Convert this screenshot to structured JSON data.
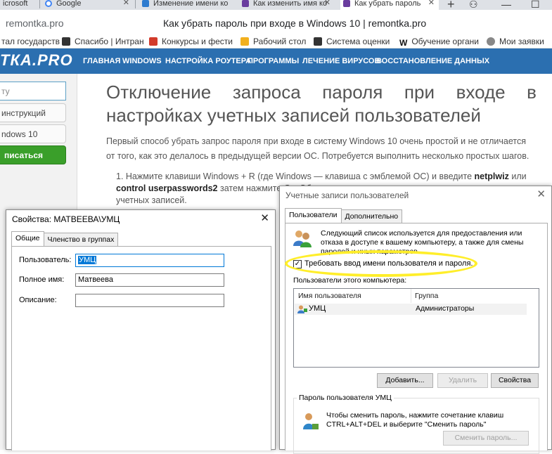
{
  "browser": {
    "tabs": [
      {
        "label": "icrosoft",
        "icon_color": "#2e7bcf"
      },
      {
        "label": "Google",
        "icon_color": "#4285f4"
      },
      {
        "label": "Изменение имени ко",
        "icon_color": "#2e7bcf"
      },
      {
        "label": "Как изменить имя ко",
        "icon_color": "#6a3c9e"
      },
      {
        "label": "Как убрать пароль",
        "icon_color": "#6a3c9e"
      }
    ],
    "url_host": "remontka.pro",
    "page_title": "Как убрать пароль при входе в Windows 10 | remontka.pro",
    "bookmarks": [
      {
        "label": "тал государств",
        "icon_color": "#c0392b"
      },
      {
        "label": "Спасибо | Интран",
        "icon_color": "#333333"
      },
      {
        "label": "Конкурсы и фести",
        "icon_color": "#d23b2b"
      },
      {
        "label": "Рабочий стол",
        "icon_color": "#f2b01e"
      },
      {
        "label": "Система оценки",
        "icon_color": "#333333"
      },
      {
        "label": "Обучение органи",
        "icon_color": "#111111"
      },
      {
        "label": "Мои заявки",
        "icon_color": "#555555"
      }
    ]
  },
  "site": {
    "logo": "ТКА.PRO",
    "nav": [
      "ГЛАВНАЯ",
      "WINDOWS",
      "НАСТРОЙКА РОУТЕРА",
      "ПРОГРАММЫ",
      "ЛЕЧЕНИЕ ВИРУСОВ",
      "ВОССТАНОВЛЕНИЕ ДАННЫХ"
    ],
    "sidebar": {
      "search_placeholder": "ту",
      "btn1": "инструкций",
      "btn2": "ndows 10",
      "subscribe": "писаться"
    },
    "article": {
      "heading_line1": "Отключение запроса пароля при входе в",
      "heading_line2": "настройках учетных записей пользователей",
      "paragraph": "Первый способ убрать запрос пароля при входе в систему Windows 10 очень простой и не отличается от того, как это делалось в предыдущей версии ОС. Потребуется выполнить несколько простых шагов.",
      "li_pre": "1. Нажмите клавиши Windows + R (где Windows — клавиша с эмблемой ОС) и введите ",
      "li_b1": "netplwiz",
      "li_mid": " или ",
      "li_b2": "control userpasswords2",
      "li_post": " затем нажмите Ок. Обе",
      "li_line3": "учетных записей."
    }
  },
  "props_dialog": {
    "title": "Свойства: МАТВЕЕВА\\УМЦ",
    "tabs": [
      "Общие",
      "Членство в группах"
    ],
    "username_label": "Пользователь:",
    "username_value": "УМЦ",
    "fullname_label": "Полное имя:",
    "fullname_value": "Матвеева",
    "description_label": "Описание:",
    "description_value": ""
  },
  "accounts_dialog": {
    "title": "Учетные записи пользователей",
    "tabs": [
      "Пользователи",
      "Дополнительно"
    ],
    "description": "Следующий список используется для предоставления или отказа в доступе к вашему компьютеру, а также для смены паролей и иных параметров.",
    "require_login_label": "Требовать ввод имени пользователя и пароля.",
    "require_login_checked": true,
    "users_label": "Пользователи этого компьютера:",
    "columns": [
      "Имя пользователя",
      "Группа"
    ],
    "rows": [
      {
        "user": "УМЦ",
        "group": "Администраторы"
      }
    ],
    "add_button": "Добавить...",
    "remove_button": "Удалить",
    "properties_button": "Свойства",
    "password_group_title": "Пароль пользователя УМЦ",
    "password_hint": "Чтобы сменить пароль, нажмите сочетание клавиш CTRL+ALT+DEL и выберите \"Сменить пароль\"",
    "change_password_button": "Сменить пароль...",
    "highlight_color": "#ffee2a"
  }
}
